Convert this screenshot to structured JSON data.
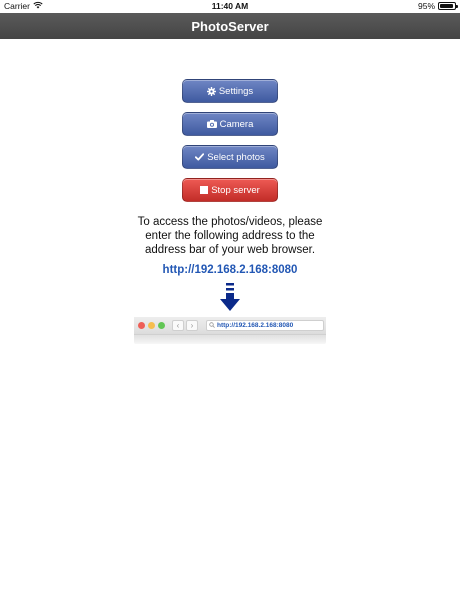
{
  "status_bar": {
    "carrier": "Carrier",
    "time": "11:40 AM",
    "battery": "95%",
    "battery_level": 0.95,
    "icons": [
      "wifi-icon",
      "battery-icon"
    ]
  },
  "nav": {
    "title": "PhotoServer"
  },
  "buttons": {
    "settings": {
      "label": "Settings",
      "icon": "gear-icon"
    },
    "camera": {
      "label": "Camera",
      "icon": "camera-icon"
    },
    "select_photos": {
      "label": "Select photos",
      "icon": "checkmark-icon"
    },
    "stop_server": {
      "label": "Stop server",
      "icon": "stop-square-icon"
    }
  },
  "instructions": {
    "line1": "To access the photos/videos, please",
    "line2": "enter the following address to the",
    "line3": "address bar of your web browser."
  },
  "address": "http://192.168.2.168:8080",
  "browser_mock": {
    "url": "http://192.168.2.168:8080",
    "back_glyph": "‹",
    "forward_glyph": "›"
  },
  "colors": {
    "nav_bg": "#4e4e4e",
    "button_blue": "#4a63aa",
    "button_red": "#d9403b",
    "link_blue": "#2257b4",
    "arrow_navy": "#0b2a8a"
  }
}
